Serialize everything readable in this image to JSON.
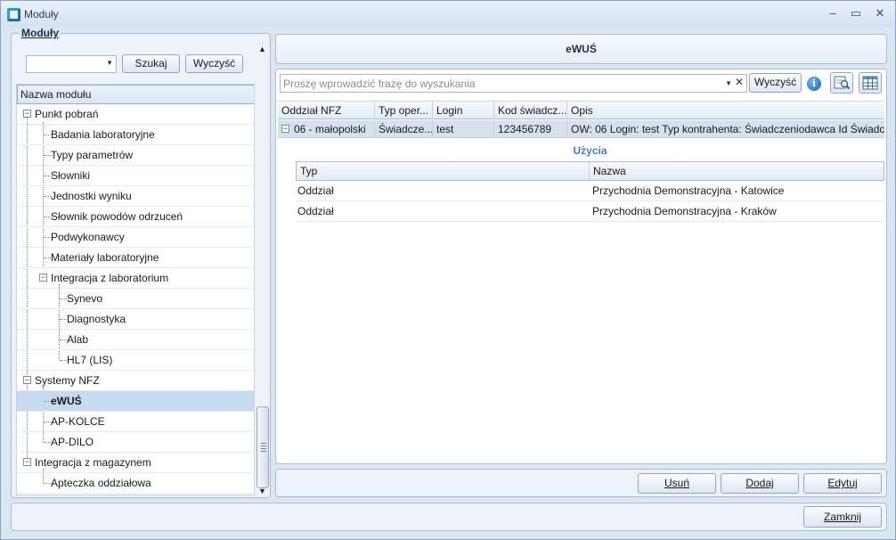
{
  "window": {
    "title": "Moduły",
    "minimize": "–",
    "maximize": "▭",
    "close": "✕"
  },
  "left": {
    "group_title": "Moduły",
    "combo_value": "",
    "search_button": "Szukaj",
    "clear_button": "Wyczyść",
    "tree_header": "Nazwa modułu",
    "tree": [
      {
        "label": "Punkt pobrań",
        "expander": "−"
      },
      {
        "label": "Badania laboratoryjne"
      },
      {
        "label": "Typy parametrów"
      },
      {
        "label": "Słowniki"
      },
      {
        "label": "Jednostki wyniku"
      },
      {
        "label": "Słownik powodów odrzuceń"
      },
      {
        "label": "Podwykonawcy"
      },
      {
        "label": "Materiały laboratoryjne"
      },
      {
        "label": "Integracja z laboratorium",
        "expander": "−"
      },
      {
        "label": "Synevo"
      },
      {
        "label": "Diagnostyka"
      },
      {
        "label": "Alab"
      },
      {
        "label": "HL7 (LIS)"
      },
      {
        "label": "Systemy NFZ",
        "expander": "−"
      },
      {
        "label": "eWUŚ"
      },
      {
        "label": "AP-KOLCE"
      },
      {
        "label": "AP-DILO"
      },
      {
        "label": "Integracja z magazynem",
        "expander": "−"
      },
      {
        "label": "Apteczka oddziałowa"
      }
    ]
  },
  "right": {
    "module_title": "eWUŚ",
    "search_placeholder": "Proszę wprowadzić frazę do wyszukania",
    "clear_button": "Wyczyść",
    "info_glyph": "i",
    "columns": [
      "Oddział NFZ",
      "Typ oper...",
      "Login",
      "Kod świadcz...",
      "Opis"
    ],
    "row": {
      "expander": "−",
      "cells": [
        "06 - małopolski",
        "Świadcze...",
        "test",
        "123456789",
        "OW: 06  Login: test  Typ kontrahenta: Świadczeniodawca  Id Świadc..."
      ]
    },
    "detail_title": "Użycia",
    "detail_columns": [
      "Typ",
      "Nazwa"
    ],
    "detail_rows": [
      [
        "Oddział",
        "Przychodnia Demonstracyjna - Katowice"
      ],
      [
        "Oddział",
        "Przychodnia Demonstracyjna - Kraków"
      ]
    ],
    "buttons": {
      "delete": "Usuń",
      "add": "Dodaj",
      "edit": "Edytuj"
    }
  },
  "footer": {
    "close_button": "Zamknij"
  }
}
